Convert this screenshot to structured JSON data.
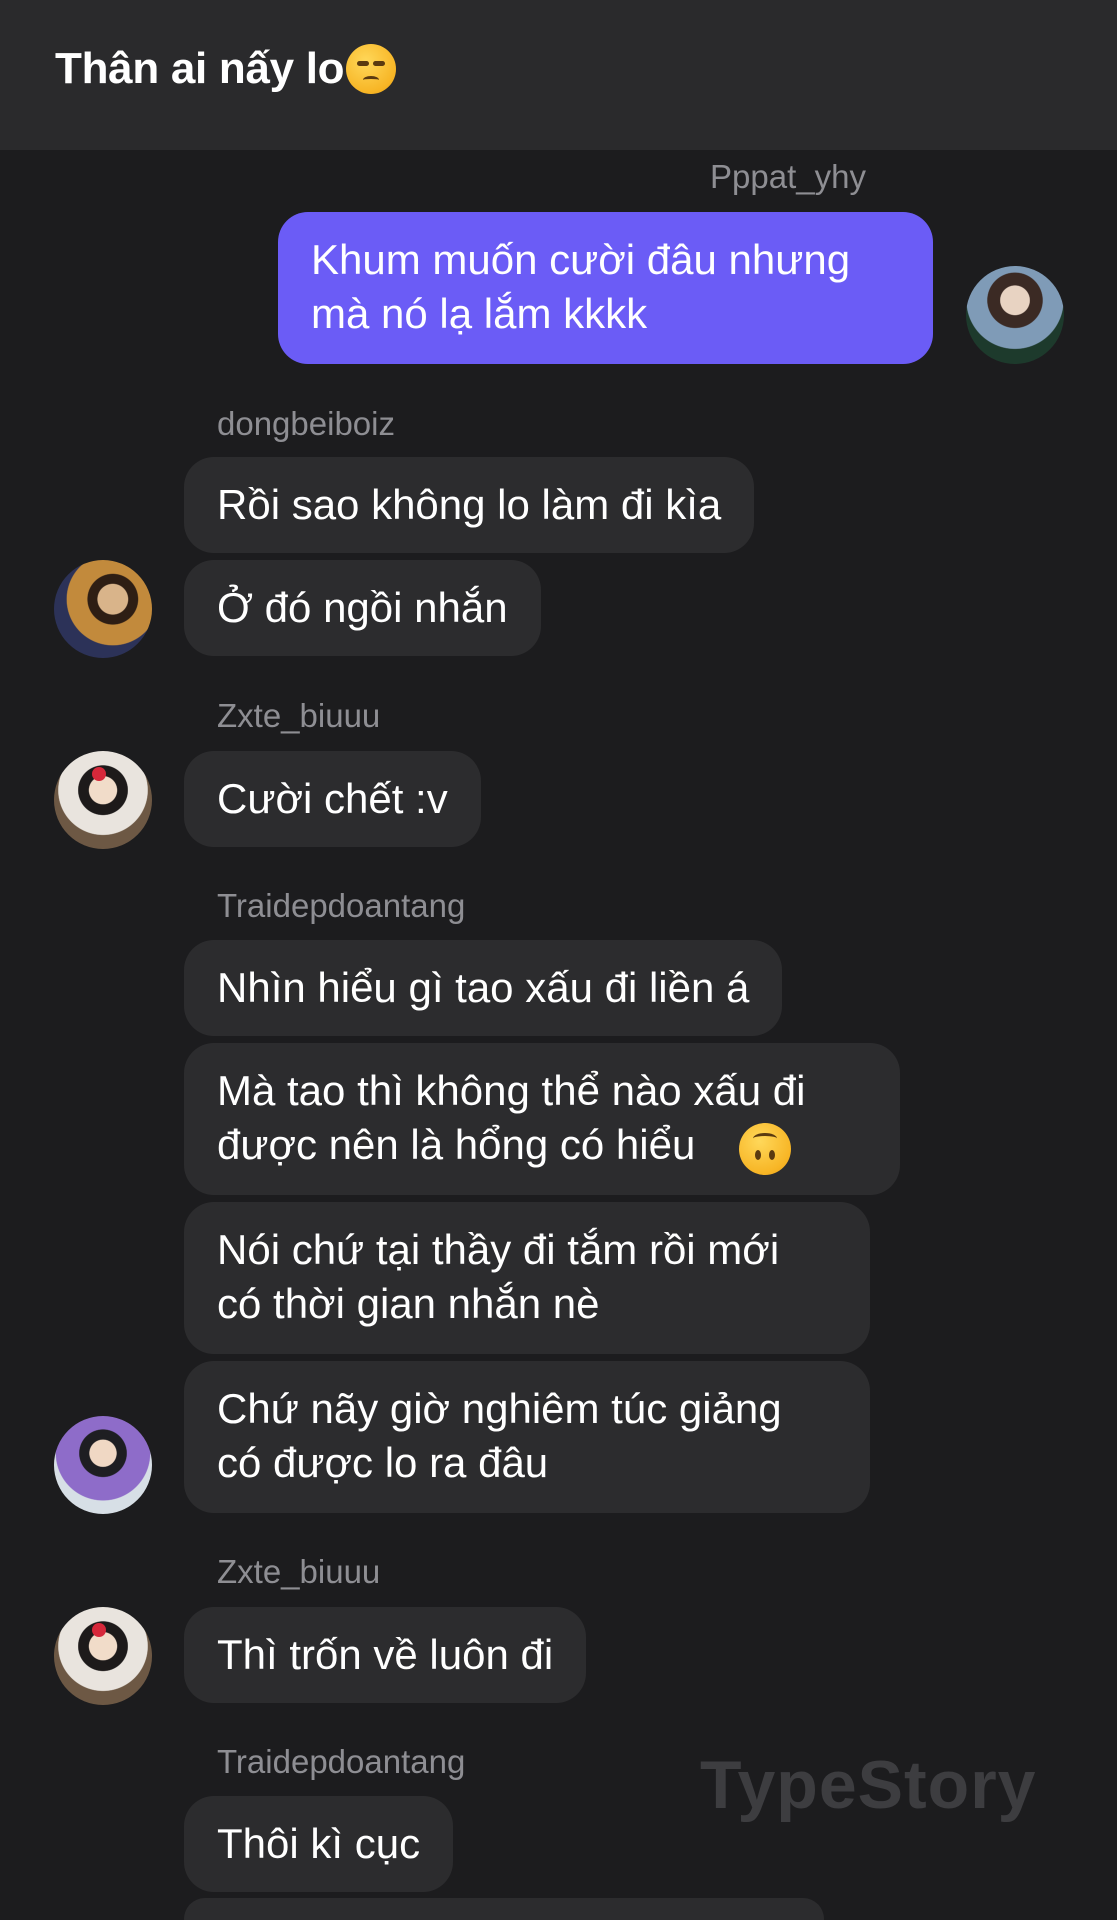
{
  "header": {
    "title": "Thân ai nấy lo",
    "emoji": "unamused-face"
  },
  "messages": [
    {
      "sender": "Pppat_yhy",
      "side": "right",
      "bubbles": [
        "Khum muốn cười đâu nhưng\nmà nó lạ lắm kkkk"
      ]
    },
    {
      "sender": "dongbeiboiz",
      "side": "left",
      "bubbles": [
        "Rồi sao không lo làm đi kìa",
        "Ở đó ngồi nhắn"
      ]
    },
    {
      "sender": "Zxte_biuuu",
      "side": "left",
      "bubbles": [
        "Cười chết :v"
      ]
    },
    {
      "sender": "Traidepdoantang",
      "side": "left",
      "bubbles": [
        "Nhìn hiểu gì tao xấu đi liền á",
        "Mà tao thì không thể nào xấu đi\nđược nên là hổng có hiểu",
        "Nói chứ tại thầy đi tắm rồi mới\ncó thời gian nhắn nè",
        "Chứ nãy giờ nghiêm túc giảng\ncó được lo ra đâu"
      ]
    },
    {
      "sender": "Zxte_biuuu",
      "side": "left",
      "bubbles": [
        "Thì trốn về luôn đi"
      ]
    },
    {
      "sender": "Traidepdoantang",
      "side": "left",
      "bubbles": [
        "Thôi kì cục"
      ]
    }
  ],
  "watermark": "TypeStory",
  "colors": {
    "background": "#1c1c1e",
    "header": "#2a2a2c",
    "bubble": "#2c2c2e",
    "mine_bubble": "#6b5cf6",
    "sender": "#8e8e93"
  }
}
